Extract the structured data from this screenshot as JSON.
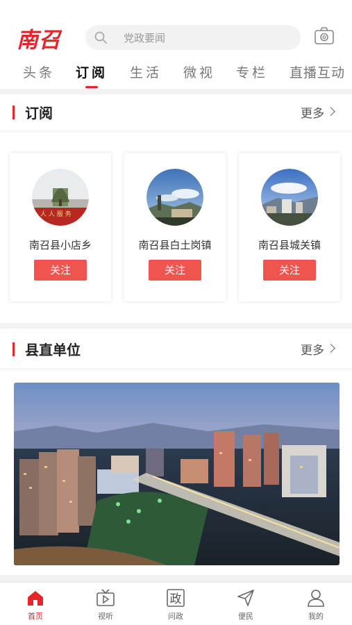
{
  "header": {
    "logo": "南召",
    "search_placeholder": "党政要闻",
    "camera_icon": "camera-icon",
    "search_icon": "search-icon"
  },
  "tabs": [
    {
      "label": "头条",
      "active": false
    },
    {
      "label": "订阅",
      "active": true
    },
    {
      "label": "生活",
      "active": false
    },
    {
      "label": "微视",
      "active": false
    },
    {
      "label": "专栏",
      "active": false
    },
    {
      "label": "直播互动",
      "active": false
    }
  ],
  "subscribe": {
    "title": "订阅",
    "more": "更多",
    "cards": [
      {
        "name": "南召县小店乡",
        "button": "关注"
      },
      {
        "name": "南召县白土岗镇",
        "button": "关注"
      },
      {
        "name": "南召县城关镇",
        "button": "关注"
      }
    ]
  },
  "county": {
    "title": "县直单位",
    "more": "更多"
  },
  "bottom_nav": [
    {
      "label": "首页",
      "icon": "home-icon",
      "active": true
    },
    {
      "label": "视听",
      "icon": "tv-icon",
      "active": false
    },
    {
      "label": "问政",
      "icon": "zheng-icon",
      "glyph": "政",
      "active": false
    },
    {
      "label": "便民",
      "icon": "send-icon",
      "active": false
    },
    {
      "label": "我的",
      "icon": "user-icon",
      "active": false
    }
  ],
  "colors": {
    "accent": "#e4262b",
    "button": "#f0544f",
    "separator": "#f2f2f2"
  }
}
